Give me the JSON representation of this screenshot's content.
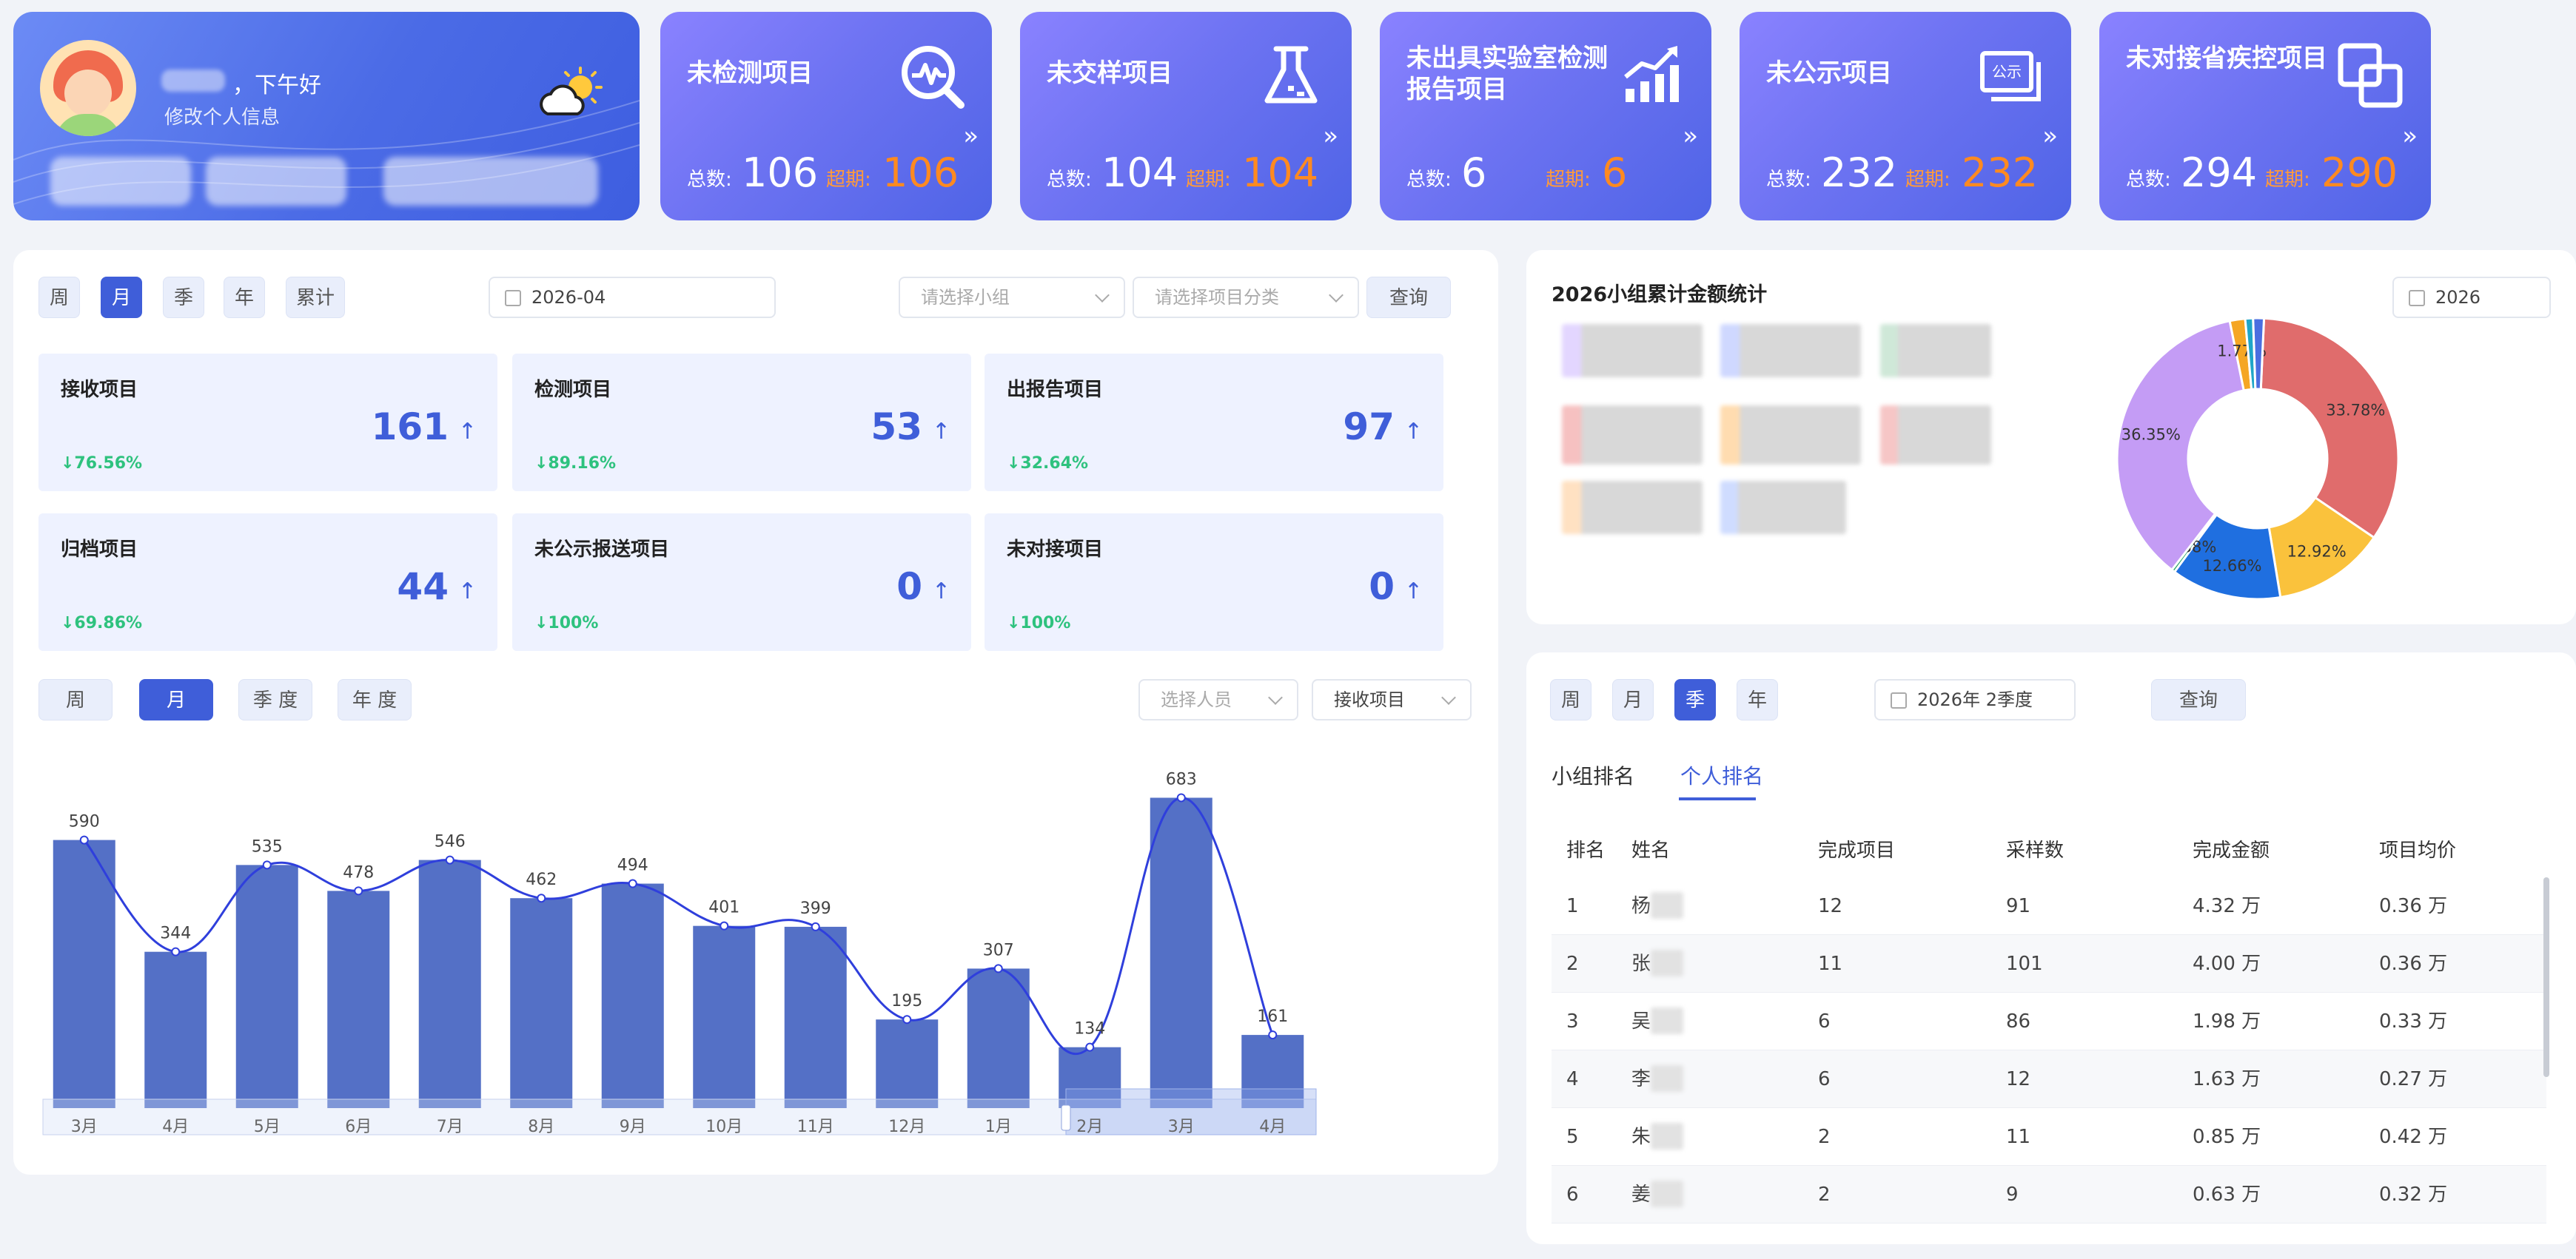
{
  "user": {
    "greeting": "，下午好",
    "edit_profile": "修改个人信息"
  },
  "stat_cards": [
    {
      "title": "未检测项目",
      "total_label": "总数:",
      "total": "106",
      "overdue_label": "超期:",
      "overdue": "106",
      "icon": "search-chart-icon"
    },
    {
      "title": "未交样项目",
      "total_label": "总数:",
      "total": "104",
      "overdue_label": "超期:",
      "overdue": "104",
      "icon": "flask-icon"
    },
    {
      "title": "未出具实验室检测报告项目",
      "total_label": "总数:",
      "total": "6",
      "overdue_label": "超期:",
      "overdue": "6",
      "icon": "bar-trend-icon"
    },
    {
      "title": "未公示项目",
      "total_label": "总数:",
      "total": "232",
      "overdue_label": "超期:",
      "overdue": "232",
      "icon": "publicity-icon"
    },
    {
      "title": "未对接省疾控项目",
      "total_label": "总数:",
      "total": "294",
      "overdue_label": "超期:",
      "overdue": "290",
      "icon": "link-squares-icon"
    }
  ],
  "left_filters": {
    "period_buttons": [
      "周",
      "月",
      "季",
      "年",
      "累计"
    ],
    "active_period": "月",
    "date": "2026-04",
    "group_placeholder": "请选择小组",
    "category_placeholder": "请选择项目分类",
    "query": "查询"
  },
  "metrics": [
    {
      "title": "接收项目",
      "value": "161",
      "arrow": "↑",
      "change": "↓76.56%"
    },
    {
      "title": "检测项目",
      "value": "53",
      "arrow": "↑",
      "change": "↓89.16%"
    },
    {
      "title": "出报告项目",
      "value": "97",
      "arrow": "↑",
      "change": "↓32.64%"
    },
    {
      "title": "归档项目",
      "value": "44",
      "arrow": "↑",
      "change": "↓69.86%"
    },
    {
      "title": "未公示报送项目",
      "value": "0",
      "arrow": "↑",
      "change": "↓100%"
    },
    {
      "title": "未对接项目",
      "value": "0",
      "arrow": "↑",
      "change": "↓100%"
    }
  ],
  "chart_filters": {
    "period_buttons": [
      "周",
      "月",
      "季 度",
      "年 度"
    ],
    "active_period": "月",
    "person_placeholder": "选择人员",
    "metric_select": "接收项目"
  },
  "chart_data": {
    "type": "bar",
    "categories": [
      "3月",
      "4月",
      "5月",
      "6月",
      "7月",
      "8月",
      "9月",
      "10月",
      "11月",
      "12月",
      "1月",
      "2月",
      "3月",
      "4月"
    ],
    "values": [
      590,
      344,
      535,
      478,
      546,
      462,
      494,
      401,
      399,
      195,
      307,
      134,
      683,
      161
    ],
    "overlay": "line",
    "bar_color": "#5470c6",
    "line_color": "#2f3fdc"
  },
  "pie": {
    "title": "2026小组累计金额统计",
    "year": "2026",
    "chart_data": {
      "type": "pie",
      "donut": true,
      "slices": [
        {
          "value": 33.78,
          "label": "33.78%",
          "color": "#e06c6c"
        },
        {
          "value": 12.92,
          "label": "12.92%",
          "color": "#fac23c"
        },
        {
          "value": 12.66,
          "label": "12.66%",
          "color": "#1f6fe0"
        },
        {
          "value": 0.38,
          "label": "0.38%",
          "color": "#2ba566"
        },
        {
          "value": 36.35,
          "label": "36.35%",
          "color": "#c49cf5"
        },
        {
          "value": 1.77,
          "label": "1.77%",
          "color": "#f5a623"
        },
        {
          "value": 0.9,
          "label": "",
          "color": "#1fa6c8"
        },
        {
          "value": 1.24,
          "label": "",
          "color": "#4a6ee0"
        }
      ]
    }
  },
  "ranking": {
    "period_buttons": [
      "周",
      "月",
      "季",
      "年"
    ],
    "active_period": "季",
    "date": "2026年 2季度",
    "query": "查询",
    "tabs": [
      "小组排名",
      "个人排名"
    ],
    "active_tab": "个人排名",
    "columns": [
      "排名",
      "姓名",
      "完成项目",
      "采样数",
      "完成金额",
      "项目均价"
    ],
    "rows": [
      [
        "1",
        "杨",
        "12",
        "91",
        "4.32 万",
        "0.36 万"
      ],
      [
        "2",
        "张",
        "11",
        "101",
        "4.00 万",
        "0.36 万"
      ],
      [
        "3",
        "吴",
        "6",
        "86",
        "1.98 万",
        "0.33 万"
      ],
      [
        "4",
        "李",
        "6",
        "12",
        "1.63 万",
        "0.27 万"
      ],
      [
        "5",
        "朱",
        "2",
        "11",
        "0.85 万",
        "0.42 万"
      ],
      [
        "6",
        "姜",
        "2",
        "9",
        "0.63 万",
        "0.32 万"
      ]
    ]
  }
}
